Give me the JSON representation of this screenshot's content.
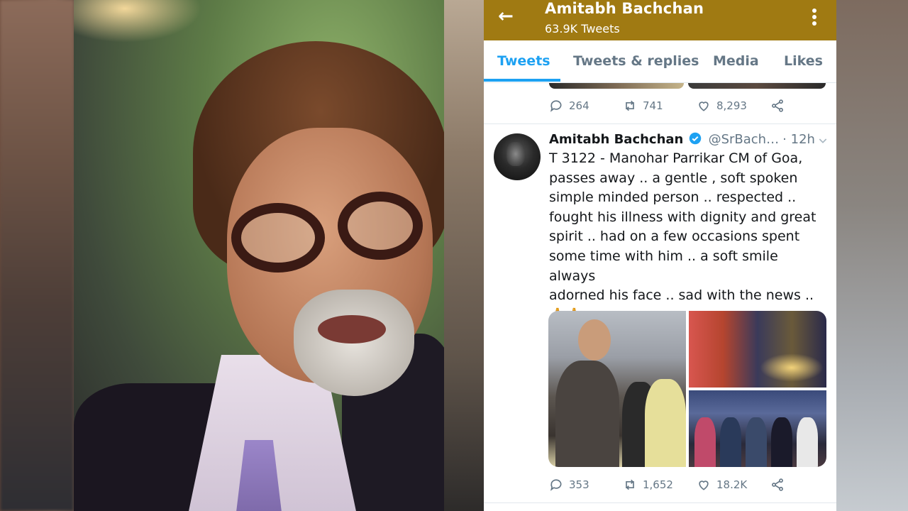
{
  "profile": {
    "name": "Amitabh Bachchan",
    "tweet_count": "63.9K Tweets"
  },
  "tabs": [
    "Tweets",
    "Tweets & replies",
    "Media",
    "Likes"
  ],
  "active_tab": "Tweets",
  "previous_tweet": {
    "replies": "264",
    "retweets": "741",
    "likes": "8,293"
  },
  "tweet": {
    "author_name": "Amitabh Bachchan",
    "handle": "@SrBach…",
    "time": "· 12h",
    "text": "T 3122 - Manohar Parrikar CM of Goa,\npasses away .. a gentle , soft spoken\nsimple minded person .. respected ..\nfought his illness with dignity and great\nspirit .. had on a few occasions spent\nsome time with him .. a soft smile always\nadorned his face .. sad with the news ..\n🙏🙏",
    "replies": "353",
    "retweets": "1,652",
    "likes": "18.2K"
  },
  "colors": {
    "appbar": "#a07a12",
    "accent": "#1da1f2",
    "muted": "#657786",
    "text": "#14171a"
  },
  "icons": {
    "back": "arrow-left-icon",
    "more": "kebab-menu-icon",
    "reply": "reply-icon",
    "retweet": "retweet-icon",
    "like": "heart-icon",
    "share": "share-icon",
    "verified": "verified-badge-icon",
    "chevron": "chevron-down-icon"
  }
}
